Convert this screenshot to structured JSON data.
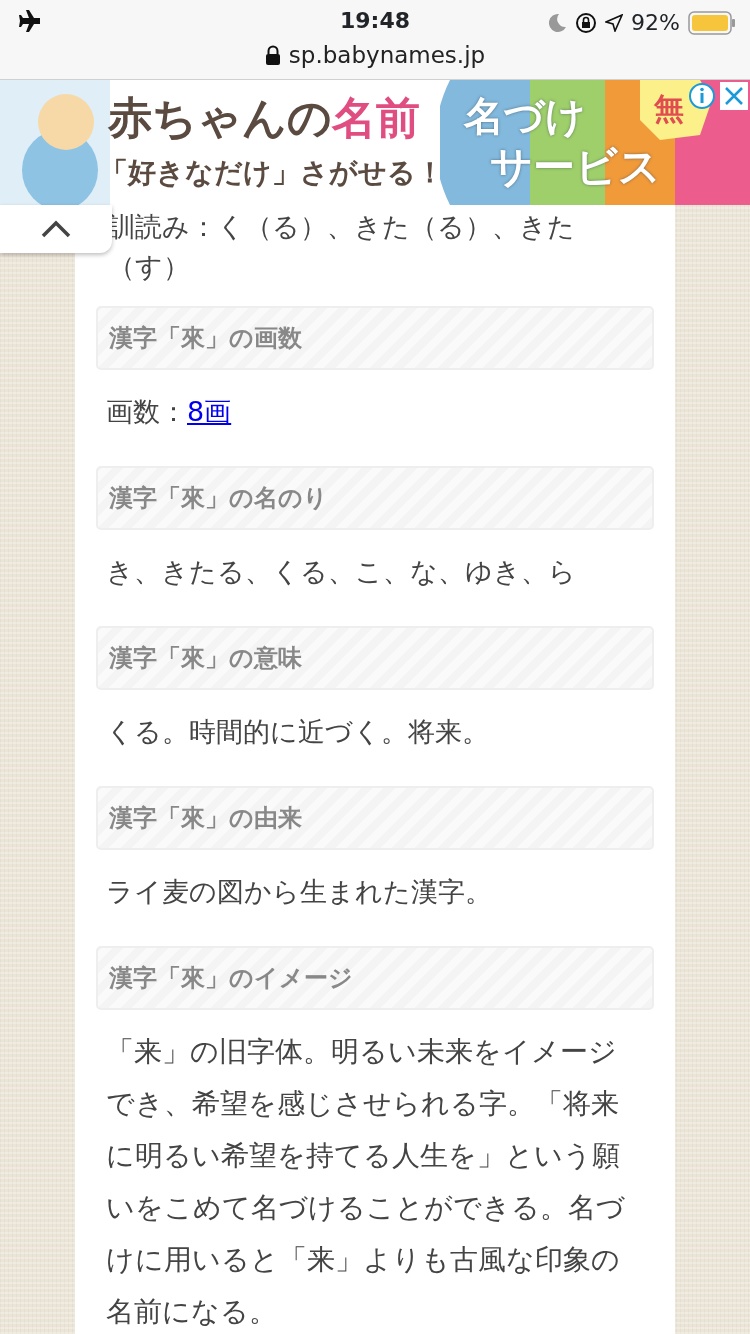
{
  "status_bar": {
    "time": "19:48",
    "battery": "92%",
    "url": "sp.babynames.jp"
  },
  "ad": {
    "title_main": "赤ちゃんの",
    "title_accent": "名前",
    "subtitle": "「好きなだけ」さがせる！",
    "service_line1": "名づけ",
    "service_line2": "サービス",
    "free": "無"
  },
  "intro": "訓読み：く（る）、きた（る）、きた（す）",
  "sections": [
    {
      "heading": "漢字「來」の画数",
      "text": "画数：",
      "link": "8画"
    },
    {
      "heading": "漢字「來」の名のり",
      "text": "き、きたる、くる、こ、な、ゆき、ら"
    },
    {
      "heading": "漢字「來」の意味",
      "text": "くる。時間的に近づく。将来。"
    },
    {
      "heading": "漢字「來」の由来",
      "text": "ライ麦の図から生まれた漢字。"
    },
    {
      "heading": "漢字「來」のイメージ",
      "text": "「来」の旧字体。明るい未来をイメージでき、希望を感じさせられる字。「将来に明るい希望を持てる人生を」という願いをこめて名づけることができる。名づけに用いると「来」よりも古風な印象の名前になる。"
    }
  ]
}
